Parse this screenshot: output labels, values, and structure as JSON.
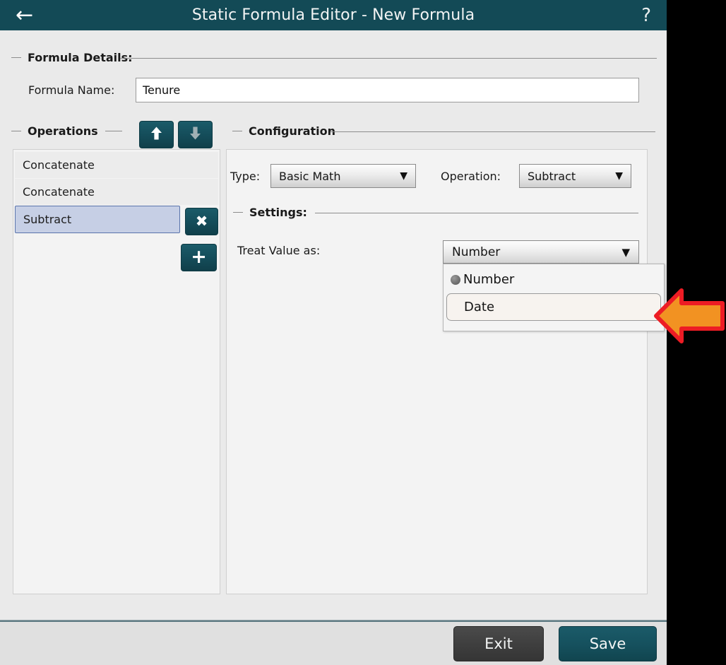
{
  "window": {
    "title": "Static Formula Editor - New Formula",
    "back_icon": "←",
    "help_icon": "?"
  },
  "formula_details": {
    "legend": "Formula Details:",
    "name_label": "Formula Name:",
    "name_value": "Tenure",
    "name_placeholder": ""
  },
  "operations": {
    "legend": "Operations",
    "move_up_icon": "arrow-up",
    "move_down_icon": "arrow-down",
    "remove_label": "✖",
    "add_label": "+",
    "items": [
      {
        "label": "Concatenate",
        "selected": false
      },
      {
        "label": "Concatenate",
        "selected": false
      },
      {
        "label": "Subtract",
        "selected": true
      }
    ]
  },
  "configuration": {
    "legend": "Configuration",
    "type_label": "Type:",
    "type_value": "Basic Math",
    "operation_label": "Operation:",
    "operation_value": "Subtract",
    "chevron": "⌄",
    "settings": {
      "legend": "Settings:",
      "treat_value_label": "Treat Value as:",
      "treat_value_selected": "Number",
      "options": [
        {
          "label": "Number",
          "selected": true
        },
        {
          "label": "Date",
          "selected": false,
          "highlighted": true
        }
      ]
    }
  },
  "footer": {
    "exit_label": "Exit",
    "save_label": "Save"
  },
  "annotation": {
    "type": "arrow-pointer",
    "direction": "left",
    "fill_color": "#F29222",
    "stroke_color": "#ED1C24",
    "outline_color": "#FFFFFF"
  },
  "theme": {
    "titlebar_color": "#134a56",
    "accent_color": "#15505d",
    "window_background": "#eaeaea",
    "panel_background": "#f3f3f3",
    "selection_color": "#c6cfe5",
    "backdrop_color": "#000000"
  }
}
